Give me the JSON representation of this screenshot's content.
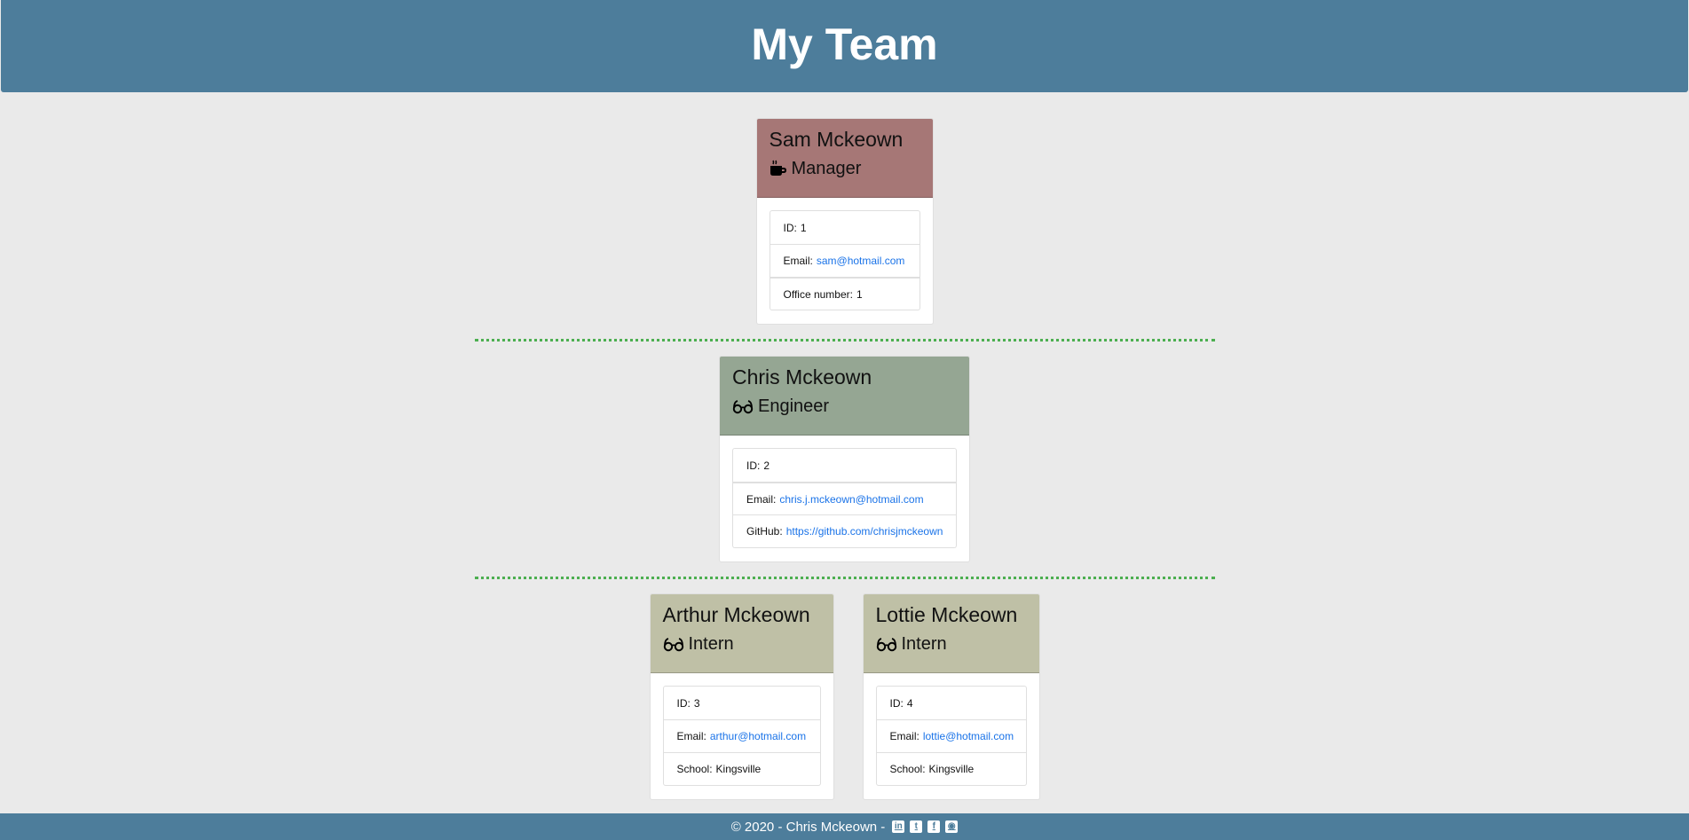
{
  "header": {
    "title": "My Team"
  },
  "colors": {
    "header_bg": "#4d7d9b",
    "page_bg": "#eaeaea",
    "manager": "#a67776",
    "engineer": "#95a693",
    "intern": "#bfc0a6",
    "divider": "#4caf50",
    "link": "#1a73e8"
  },
  "manager": {
    "name": "Sam Mckeown",
    "role": "Manager",
    "icon": "coffee-icon",
    "id_label": "ID:",
    "id": "1",
    "email_label": "Email:",
    "email": "sam@hotmail.com",
    "office_label": "Office number:",
    "office": "1"
  },
  "engineers": [
    {
      "name": "Chris Mckeown",
      "role": "Engineer",
      "icon": "glasses-icon",
      "id_label": "ID:",
      "id": "2",
      "email_label": "Email:",
      "email": "chris.j.mckeown@hotmail.com",
      "github_label": "GitHub:",
      "github": "https://github.com/chrisjmckeown"
    }
  ],
  "interns": [
    {
      "name": "Arthur Mckeown",
      "role": "Intern",
      "icon": "glasses-icon",
      "id_label": "ID:",
      "id": "3",
      "email_label": "Email:",
      "email": "arthur@hotmail.com",
      "school_label": "School:",
      "school": "Kingsville"
    },
    {
      "name": "Lottie Mckeown",
      "role": "Intern",
      "icon": "glasses-icon",
      "id_label": "ID:",
      "id": "4",
      "email_label": "Email:",
      "email": "lottie@hotmail.com",
      "school_label": "School:",
      "school": "Kingsville"
    }
  ],
  "footer": {
    "text": "© 2020 - Chris Mckeown -",
    "social": [
      {
        "name": "linkedin-icon",
        "glyph": "in"
      },
      {
        "name": "twitter-icon",
        "glyph": "t"
      },
      {
        "name": "facebook-icon",
        "glyph": "f"
      },
      {
        "name": "github-icon",
        "glyph": "◉"
      }
    ]
  }
}
